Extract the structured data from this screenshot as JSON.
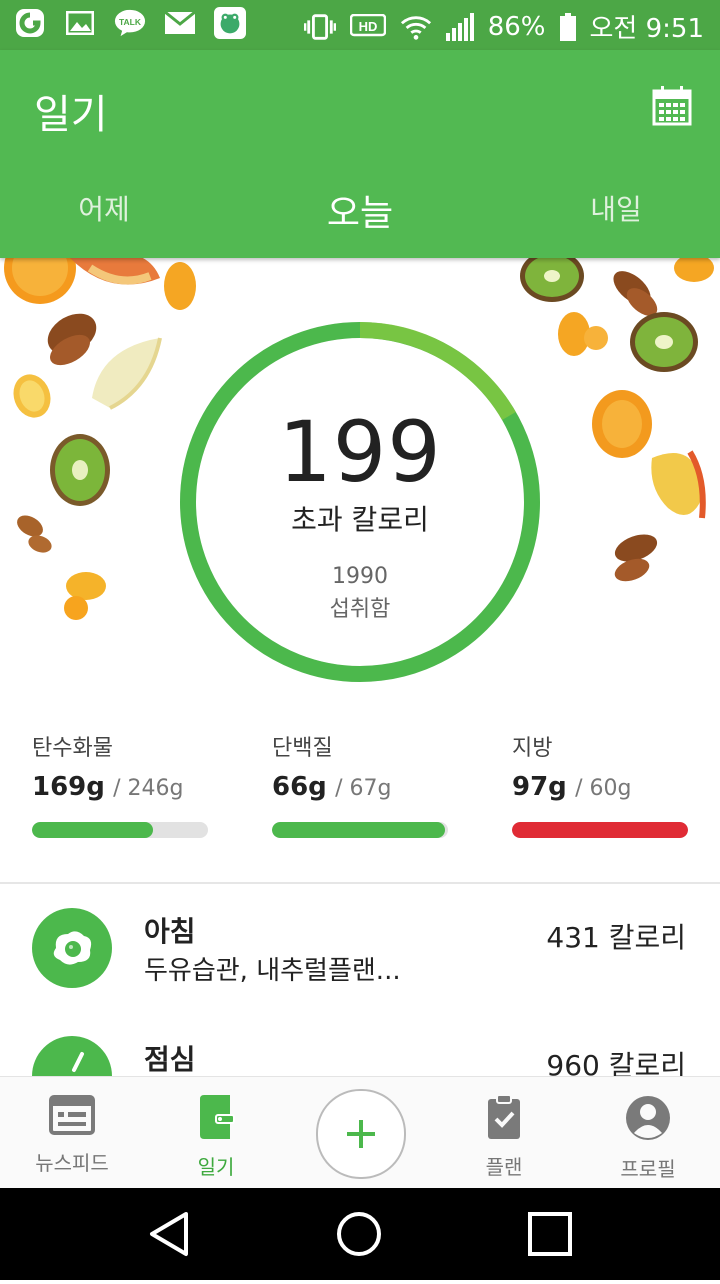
{
  "status_bar": {
    "battery": "86%",
    "time": "오전 9:51",
    "notification_icons": [
      "naver-icon",
      "gallery-icon",
      "kakaotalk-icon",
      "mail-icon",
      "frog-app-icon"
    ],
    "talk_label": "TALK",
    "hd_label": "HD"
  },
  "header": {
    "title": "일기",
    "calendar_icon": "calendar-icon",
    "tabs": [
      {
        "label": "어제",
        "active": false
      },
      {
        "label": "오늘",
        "active": true
      },
      {
        "label": "내일",
        "active": false
      }
    ]
  },
  "summary": {
    "calories_value": "199",
    "calories_label": "초과 칼로리",
    "consumed_value": "1990",
    "consumed_label": "섭취함",
    "ring_progress": 1.0,
    "ring_color": "#4cb84c",
    "ring_accent_color": "#9ccf3c"
  },
  "macros": [
    {
      "name": "탄수화물",
      "amount": "169g",
      "goal": "/ 246g",
      "progress": 0.69,
      "color": "#4cb84c"
    },
    {
      "name": "단백질",
      "amount": "66g",
      "goal": "/ 67g",
      "progress": 0.985,
      "color": "#4cb84c"
    },
    {
      "name": "지방",
      "amount": "97g",
      "goal": "/ 60g",
      "progress": 1.0,
      "color": "#e02b35"
    }
  ],
  "meals": [
    {
      "name": "아침",
      "description": "두유습관, 내추럴플랜...",
      "calories": "431 칼로리",
      "icon": "fried-egg-icon"
    },
    {
      "name": "점심",
      "description": "",
      "calories": "960 칼로리",
      "icon": "bowl-icon"
    }
  ],
  "bottom_nav": [
    {
      "label": "뉴스피드",
      "icon": "newsfeed-icon",
      "active": false
    },
    {
      "label": "일기",
      "icon": "diary-icon",
      "active": true
    },
    {
      "label": "",
      "icon": "plus-icon",
      "active": false
    },
    {
      "label": "플랜",
      "icon": "clipboard-icon",
      "active": false
    },
    {
      "label": "프로필",
      "icon": "profile-icon",
      "active": false
    }
  ],
  "colors": {
    "primary_green": "#52b952",
    "status_bar_green": "#4ca746",
    "danger_red": "#e02b35"
  }
}
